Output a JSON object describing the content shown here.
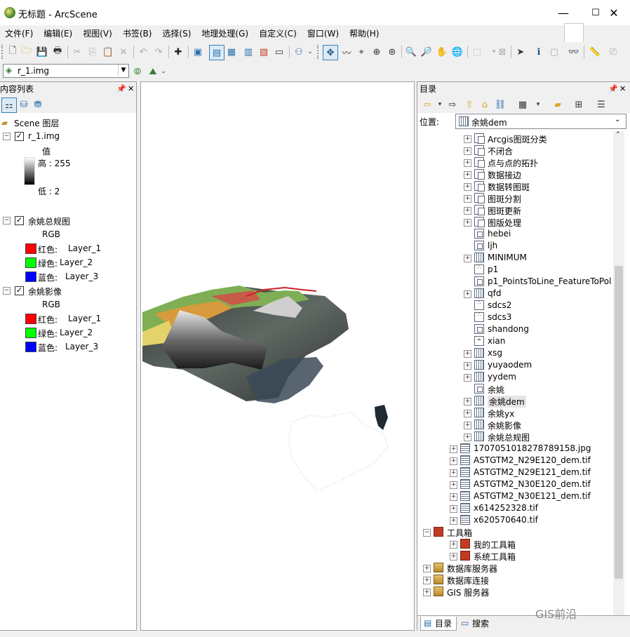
{
  "window": {
    "title": "无标题 - ArcScene",
    "minimize": "—",
    "maximize": "☐",
    "close": "✕"
  },
  "menu": [
    "文件(F)",
    "编辑(E)",
    "视图(V)",
    "书签(B)",
    "选择(S)",
    "地理处理(G)",
    "自定义(C)",
    "窗口(W)",
    "帮助(H)"
  ],
  "layer_combo": {
    "value": "r_1.img"
  },
  "toc": {
    "title": "内容列表",
    "scene_layers": "Scene 图层",
    "layers": [
      {
        "name": "r_1.img",
        "value_label": "值",
        "high": "高 : 255",
        "low": "低 : 2"
      },
      {
        "name": "余姚总规图",
        "rgb": "RGB",
        "bands": [
          {
            "label": "红色:",
            "layer": "Layer_1",
            "color": "#ff0000"
          },
          {
            "label": "绿色:",
            "layer": "Layer_2",
            "color": "#00ff00"
          },
          {
            "label": "蓝色:",
            "layer": "Layer_3",
            "color": "#0000ff"
          }
        ]
      },
      {
        "name": "余姚影像",
        "rgb": "RGB",
        "bands": [
          {
            "label": "红色:",
            "layer": "Layer_1",
            "color": "#ff0000"
          },
          {
            "label": "绿色:",
            "layer": "Layer_2",
            "color": "#00ff00"
          },
          {
            "label": "蓝色:",
            "layer": "Layer_3",
            "color": "#0000ff"
          }
        ]
      }
    ]
  },
  "catalog": {
    "title": "目录",
    "location_label": "位置:",
    "location_value": "余姚dem",
    "items": [
      {
        "label": "Arcgis图斑分类",
        "icon": "group-icon",
        "expand": true,
        "level": 1
      },
      {
        "label": "不闭合",
        "icon": "group-icon",
        "expand": true,
        "level": 1
      },
      {
        "label": "点与点的拓扑",
        "icon": "group-icon",
        "expand": true,
        "level": 1
      },
      {
        "label": "数据接边",
        "icon": "group-icon",
        "expand": true,
        "level": 1
      },
      {
        "label": "数据转图斑",
        "icon": "group-icon",
        "expand": true,
        "level": 1
      },
      {
        "label": "图斑分割",
        "icon": "group-icon",
        "expand": true,
        "level": 1
      },
      {
        "label": "图斑更新",
        "icon": "group-icon",
        "expand": true,
        "level": 1
      },
      {
        "label": "图版处理",
        "icon": "group-icon",
        "expand": true,
        "level": 1
      },
      {
        "label": "hebei",
        "icon": "polygon-icon",
        "expand": false,
        "level": 1
      },
      {
        "label": "ljh",
        "icon": "polygon-icon",
        "expand": false,
        "level": 1
      },
      {
        "label": "MINIMUM",
        "icon": "raster-icon",
        "expand": true,
        "level": 1
      },
      {
        "label": "p1",
        "icon": "point-icon",
        "expand": false,
        "level": 1
      },
      {
        "label": "p1_PointsToLine_FeatureToPol",
        "icon": "polygon-icon",
        "expand": false,
        "level": 1
      },
      {
        "label": "qfd",
        "icon": "raster-icon",
        "expand": true,
        "level": 1
      },
      {
        "label": "sdcs2",
        "icon": "point-icon",
        "expand": false,
        "level": 1
      },
      {
        "label": "sdcs3",
        "icon": "point-icon",
        "expand": false,
        "level": 1
      },
      {
        "label": "shandong",
        "icon": "polygon-icon",
        "expand": false,
        "level": 1
      },
      {
        "label": "xian",
        "icon": "line-icon",
        "expand": false,
        "level": 1
      },
      {
        "label": "xsg",
        "icon": "raster-icon",
        "expand": true,
        "level": 1
      },
      {
        "label": "yuyaodem",
        "icon": "raster-icon",
        "expand": true,
        "level": 1
      },
      {
        "label": "yydem",
        "icon": "raster-icon",
        "expand": true,
        "level": 1
      },
      {
        "label": "余姚",
        "icon": "polygon-icon",
        "expand": false,
        "level": 1
      },
      {
        "label": "余姚dem",
        "icon": "raster-icon",
        "expand": true,
        "level": 1,
        "selected": true
      },
      {
        "label": "余姚yx",
        "icon": "raster-icon",
        "expand": true,
        "level": 1
      },
      {
        "label": "余姚影像",
        "icon": "raster-icon",
        "expand": true,
        "level": 1
      },
      {
        "label": "余姚总规图",
        "icon": "raster-icon",
        "expand": true,
        "level": 1
      },
      {
        "label": "1707051018278789158.jpg",
        "icon": "file-raster-icon",
        "expand": true,
        "level": 0
      },
      {
        "label": "ASTGTM2_N29E120_dem.tif",
        "icon": "file-raster-icon",
        "expand": true,
        "level": 0
      },
      {
        "label": "ASTGTM2_N29E121_dem.tif",
        "icon": "file-raster-icon",
        "expand": true,
        "level": 0
      },
      {
        "label": "ASTGTM2_N30E120_dem.tif",
        "icon": "file-raster-icon",
        "expand": true,
        "level": 0
      },
      {
        "label": "ASTGTM2_N30E121_dem.tif",
        "icon": "file-raster-icon",
        "expand": true,
        "level": 0
      },
      {
        "label": "x614252328.tif",
        "icon": "file-raster-icon",
        "expand": true,
        "level": 0
      },
      {
        "label": "x620570640.tif",
        "icon": "file-raster-icon",
        "expand": true,
        "level": 0
      },
      {
        "label": "工具箱",
        "icon": "toolbox-icon",
        "expand": "open",
        "level": -1
      },
      {
        "label": "我的工具箱",
        "icon": "toolbox-icon",
        "expand": true,
        "level": 0
      },
      {
        "label": "系统工具箱",
        "icon": "toolbox-icon",
        "expand": true,
        "level": 0
      },
      {
        "label": "数据库服务器",
        "icon": "database-icon",
        "expand": true,
        "level": -1
      },
      {
        "label": "数据库连接",
        "icon": "database-icon",
        "expand": true,
        "level": -1
      },
      {
        "label": "GIS 服务器",
        "icon": "server-icon",
        "expand": true,
        "level": -1
      }
    ],
    "tabs": [
      "目录",
      "搜索"
    ],
    "watermark": "GIS前沿"
  }
}
